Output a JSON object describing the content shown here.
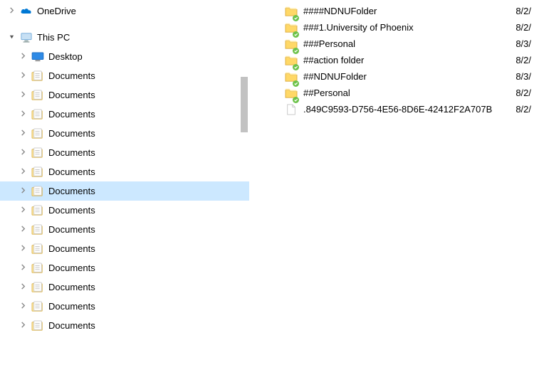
{
  "nav": {
    "onedrive": {
      "label": "OneDrive",
      "expander": "closed"
    },
    "thispc": {
      "label": "This PC",
      "expander": "open"
    },
    "desktop": {
      "label": "Desktop",
      "expander": "closed"
    },
    "doc_label": "Documents",
    "doc_count": 14,
    "selected_index": 6
  },
  "files": [
    {
      "name": "####NDNUFolder",
      "kind": "folder-sync",
      "date": "8/2/"
    },
    {
      "name": "###1.University of Phoenix",
      "kind": "folder-sync",
      "date": "8/2/"
    },
    {
      "name": "###Personal",
      "kind": "folder-sync",
      "date": "8/3/"
    },
    {
      "name": "##action folder",
      "kind": "folder-sync",
      "date": "8/2/"
    },
    {
      "name": "##NDNUFolder",
      "kind": "folder-sync",
      "date": "8/3/"
    },
    {
      "name": "##Personal",
      "kind": "folder-sync",
      "date": "8/2/"
    },
    {
      "name": ".849C9593-D756-4E56-8D6E-42412F2A707B",
      "kind": "file",
      "date": "8/2/"
    }
  ]
}
